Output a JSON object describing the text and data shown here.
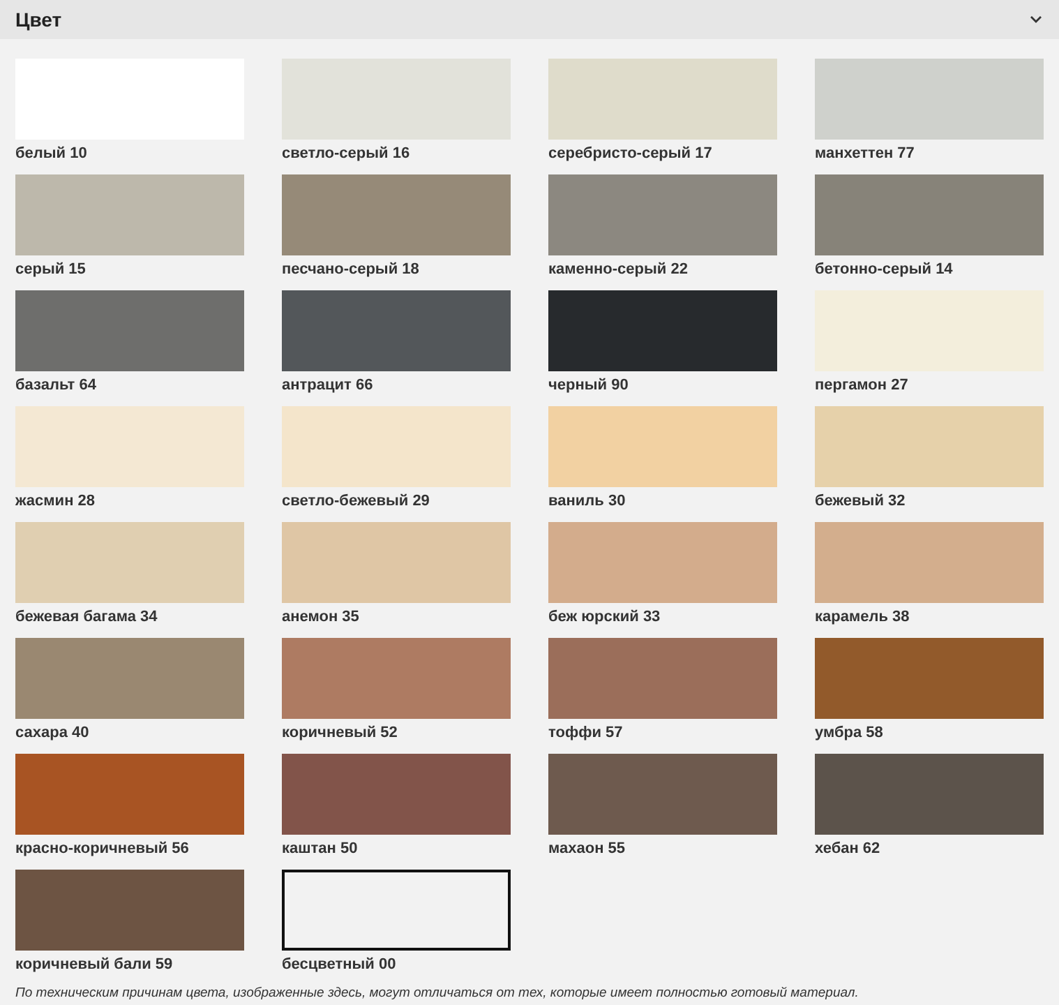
{
  "section": {
    "title": "Цвет",
    "expanded": true
  },
  "swatches": [
    {
      "kind": "fill",
      "color": "#ffffff",
      "label": "белый 10"
    },
    {
      "kind": "fill",
      "color": "#e2e2da",
      "label": "светло-серый 16"
    },
    {
      "kind": "fill",
      "color": "#dfdccb",
      "label": "серебристо-серый 17"
    },
    {
      "kind": "fill",
      "color": "#cfd1cc",
      "label": "манхеттен 77"
    },
    {
      "kind": "fill",
      "color": "#bdb8ab",
      "label": "серый 15"
    },
    {
      "kind": "fill",
      "color": "#968a78",
      "label": "песчано-серый 18"
    },
    {
      "kind": "fill",
      "color": "#8c8880",
      "label": "каменно-серый 22"
    },
    {
      "kind": "fill",
      "color": "#878379",
      "label": "бетонно-серый 14"
    },
    {
      "kind": "fill",
      "color": "#6e6e6c",
      "label": "базальт 64"
    },
    {
      "kind": "fill",
      "color": "#53575a",
      "label": "антрацит 66"
    },
    {
      "kind": "fill",
      "color": "#272a2d",
      "label": "черный 90"
    },
    {
      "kind": "fill",
      "color": "#f3eedc",
      "label": "пергамон 27"
    },
    {
      "kind": "fill",
      "color": "#f4e8d3",
      "label": "жасмин 28"
    },
    {
      "kind": "fill",
      "color": "#f4e5cb",
      "label": "светло-бежевый 29"
    },
    {
      "kind": "fill",
      "color": "#f2d1a2",
      "label": "ваниль 30"
    },
    {
      "kind": "fill",
      "color": "#e6d1aa",
      "label": "бежевый 32"
    },
    {
      "kind": "fill",
      "color": "#e0cfb1",
      "label": "бежевая багама 34"
    },
    {
      "kind": "fill",
      "color": "#dfc6a5",
      "label": "анемон 35"
    },
    {
      "kind": "fill",
      "color": "#d3ac8c",
      "label": "беж юрский 33"
    },
    {
      "kind": "fill",
      "color": "#d3ae8d",
      "label": "карамель 38"
    },
    {
      "kind": "fill",
      "color": "#9a8871",
      "label": "сахара 40"
    },
    {
      "kind": "fill",
      "color": "#ae7b62",
      "label": "коричневый 52"
    },
    {
      "kind": "fill",
      "color": "#9b6e5a",
      "label": "тоффи 57"
    },
    {
      "kind": "fill",
      "color": "#925a2b",
      "label": "умбра 58"
    },
    {
      "kind": "fill",
      "color": "#a85423",
      "label": "красно-коричневый 56"
    },
    {
      "kind": "fill",
      "color": "#82544a",
      "label": "каштан 50"
    },
    {
      "kind": "fill",
      "color": "#6e5a4e",
      "label": "махаон 55"
    },
    {
      "kind": "fill",
      "color": "#5c534b",
      "label": "хебан 62"
    },
    {
      "kind": "fill",
      "color": "#6d5443",
      "label": "коричневый бали 59"
    },
    {
      "kind": "clear",
      "label": "бесцветный 00"
    }
  ],
  "footnote": "По техническим причинам цвета, изображенные здесь, могут отличаться от тех, которые имеет полностью готовый материал."
}
